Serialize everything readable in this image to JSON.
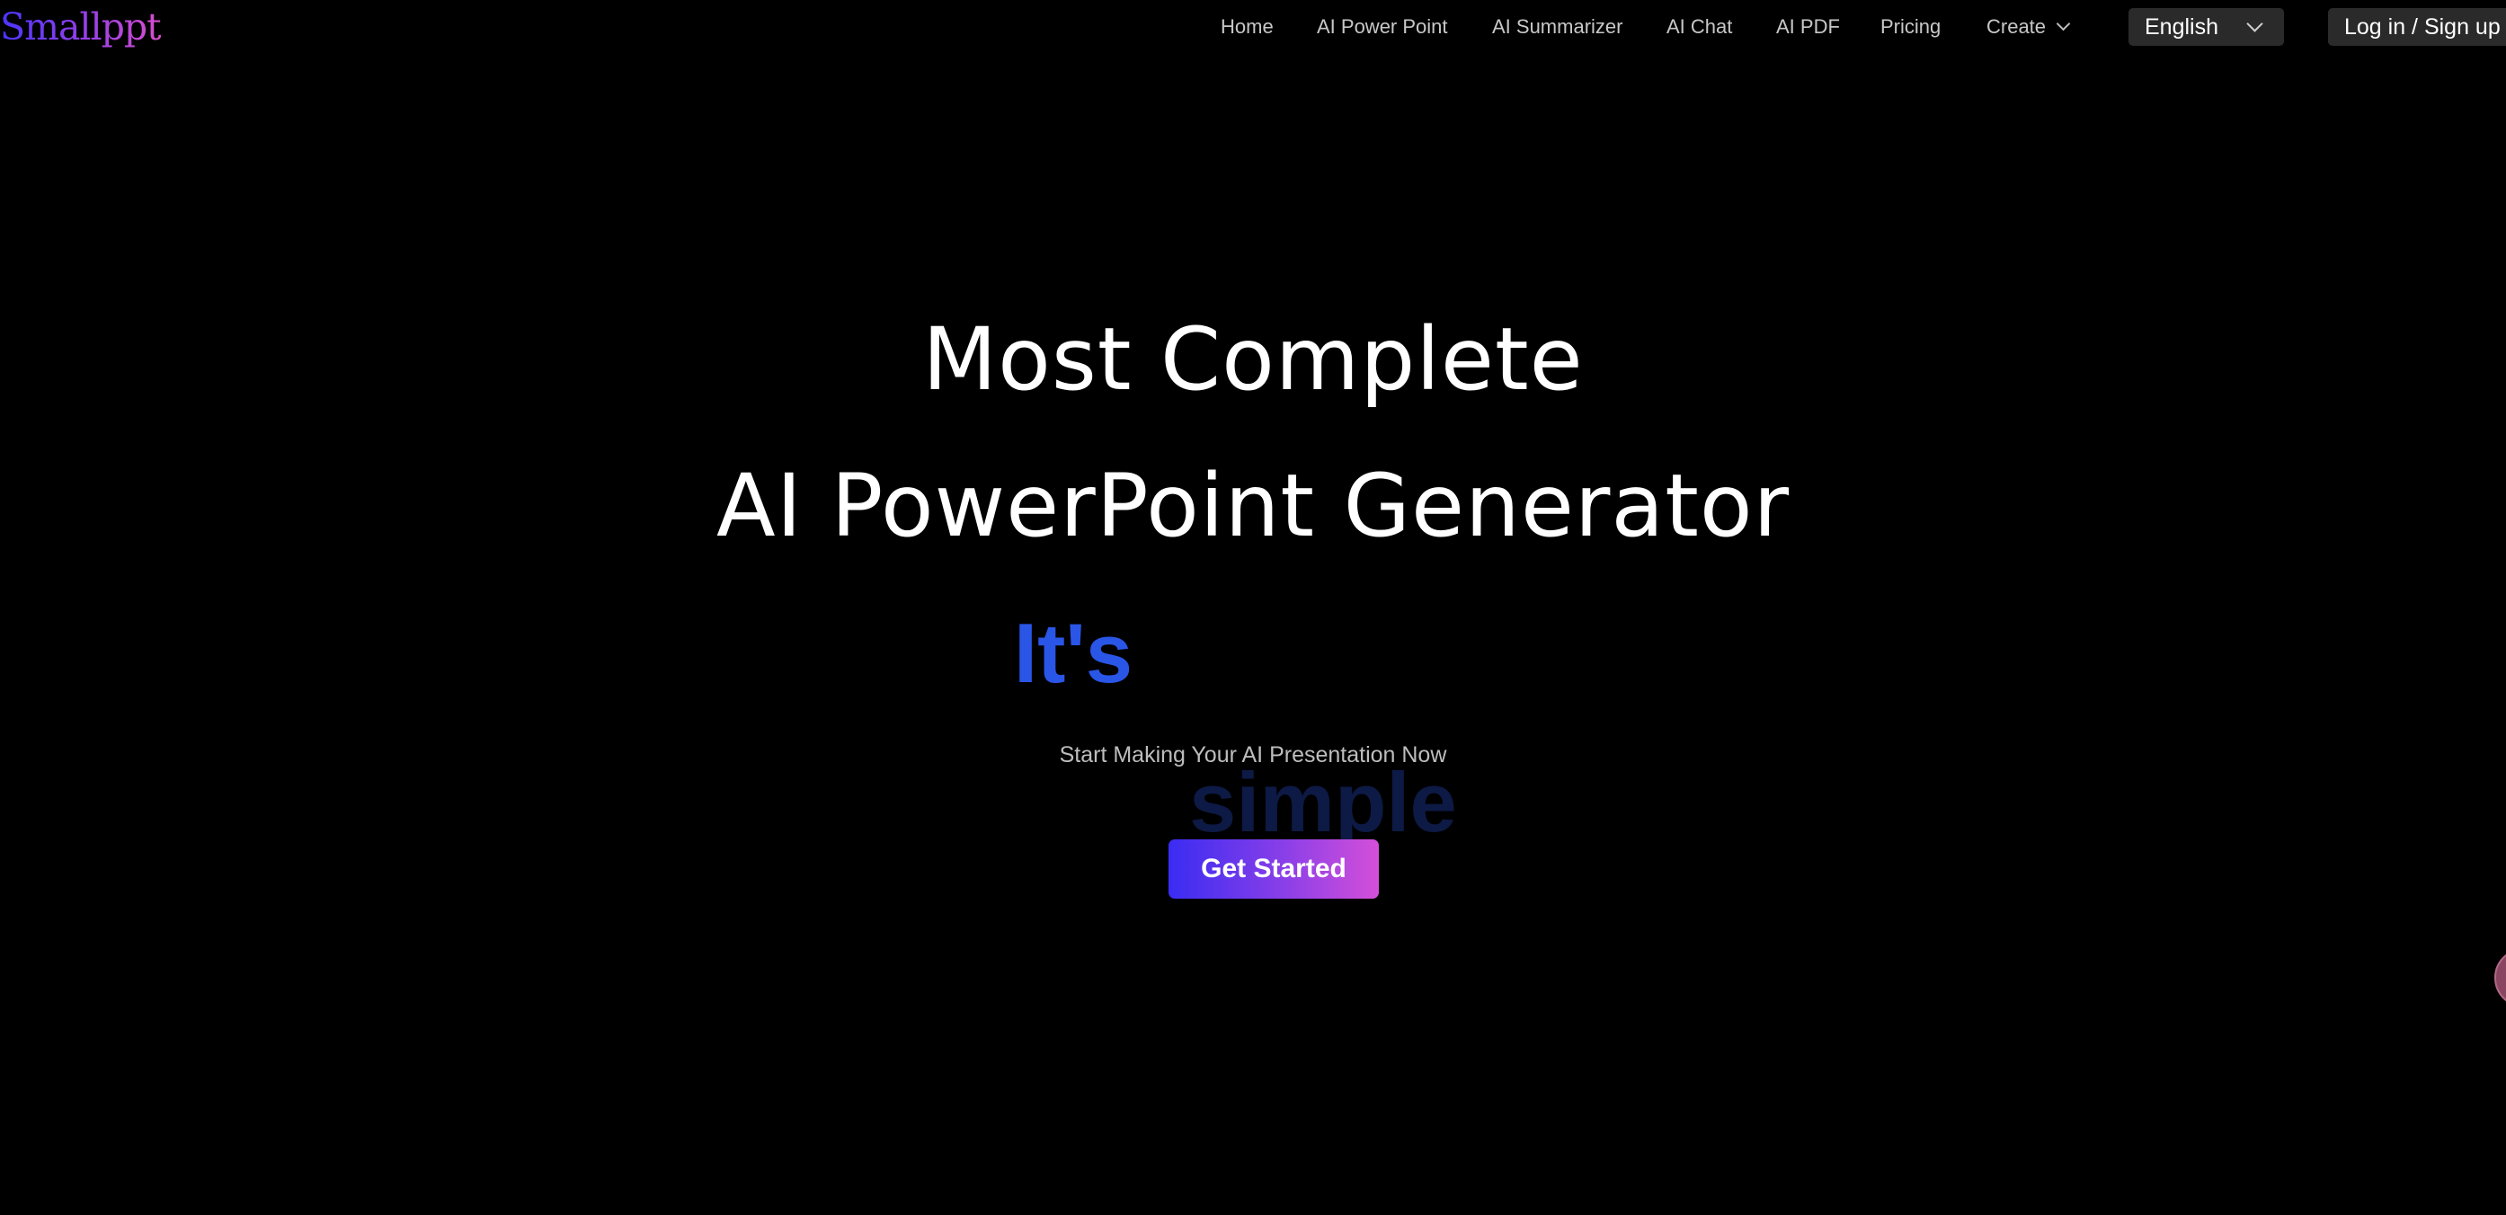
{
  "brand": {
    "logo_text": "Smallppt"
  },
  "nav": {
    "items": [
      {
        "label": "Home"
      },
      {
        "label": "AI Power Point"
      },
      {
        "label": "AI Summarizer"
      },
      {
        "label": "AI Chat"
      },
      {
        "label": "AI PDF"
      },
      {
        "label": "Pricing"
      },
      {
        "label": "Create"
      }
    ],
    "language": "English",
    "login_label": "Log in / Sign up"
  },
  "hero": {
    "line1": "Most Complete",
    "line2": "AI PowerPoint Generator",
    "prefix": "It's",
    "rotating_word": "simple",
    "subtitle": "Start Making Your AI Presentation Now",
    "cta_label": "Get Started"
  },
  "colors": {
    "background": "#000000",
    "accent_blue": "#2a56e8",
    "gradient_start": "#3a2cf2",
    "gradient_end": "#d54fd9"
  },
  "icons": {
    "create_dropdown": "chevron-down-icon",
    "language_dropdown": "chevron-down-icon",
    "chat_widget": "chat-bubble-icon"
  }
}
